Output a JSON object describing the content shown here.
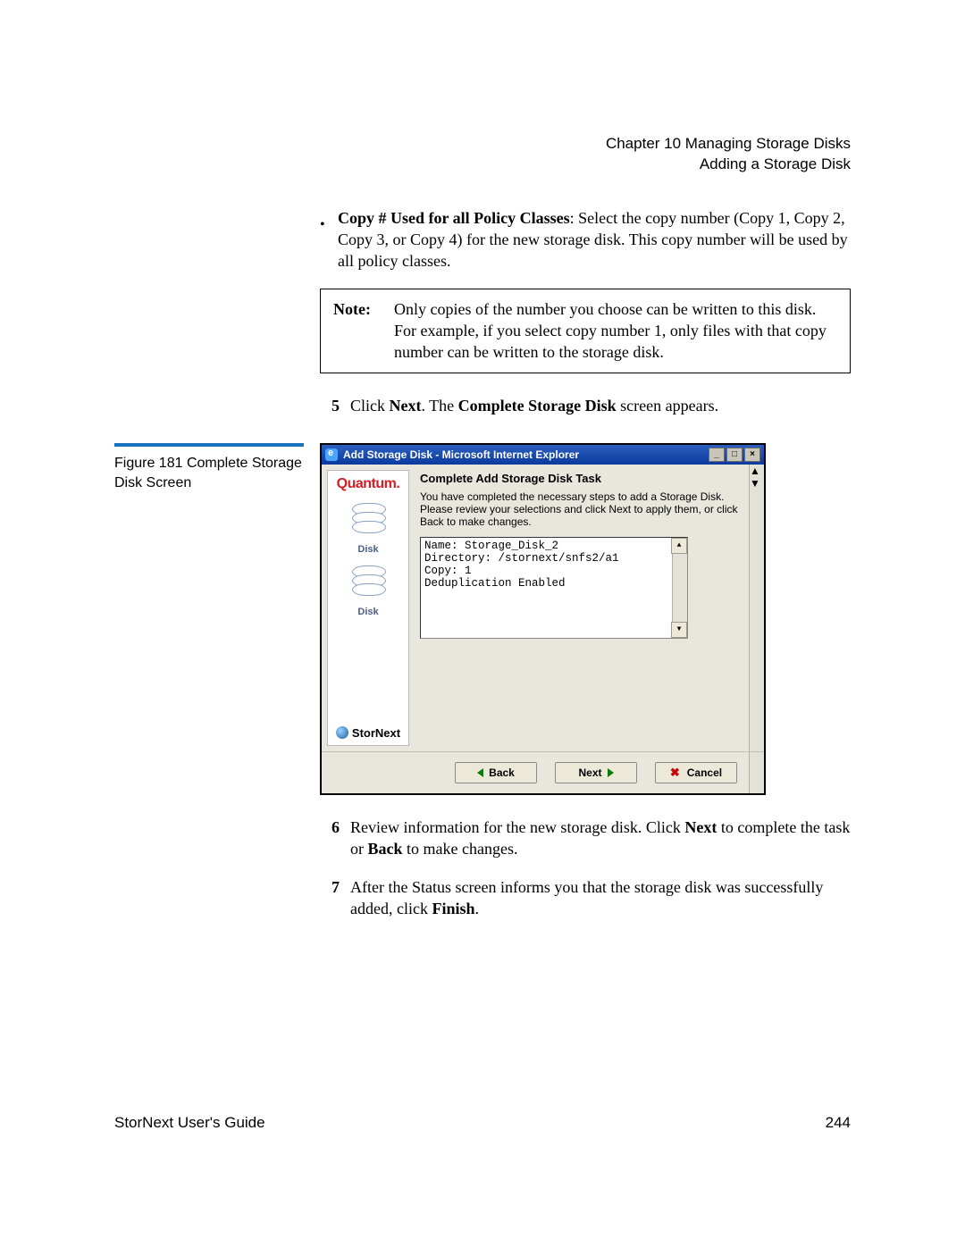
{
  "header": {
    "chapter": "Chapter 10  Managing Storage Disks",
    "section": "Adding a Storage Disk"
  },
  "bullet": {
    "label": "Copy # Used for all Policy Classes",
    "text": ": Select the copy number (Copy 1, Copy 2, Copy 3, or Copy 4) for the new storage disk. This copy number will be used by all policy classes."
  },
  "note": {
    "label": "Note:",
    "text": "Only copies of the number you choose can be written to this disk. For example, if you select copy number 1, only files with that copy number can be written to the storage disk."
  },
  "step5": {
    "num": "5",
    "a": "Click ",
    "b": "Next",
    "c": ". The ",
    "d": "Complete Storage Disk",
    "e": " screen appears."
  },
  "figure": {
    "caption": "Figure 181  Complete Storage Disk Screen"
  },
  "screenshot": {
    "title": "Add Storage Disk - Microsoft Internet Explorer",
    "brand": "Quantum.",
    "diskLabel": "Disk",
    "stornext": "StorNext",
    "heading": "Complete Add Storage Disk Task",
    "desc": "You have completed the necessary steps to add a Storage Disk. Please review your selections and click Next to apply them, or click Back to make changes.",
    "review": "Name: Storage_Disk_2\nDirectory: /stornext/snfs2/a1\nCopy: 1\nDeduplication Enabled",
    "buttons": {
      "back": "Back",
      "next": "Next",
      "cancel": "Cancel"
    }
  },
  "step6": {
    "num": "6",
    "a": "Review information for the new storage disk. Click ",
    "b": "Next",
    "c": " to complete the task or ",
    "d": "Back",
    "e": " to make changes."
  },
  "step7": {
    "num": "7",
    "a": "After the Status screen informs you that the storage disk was successfully added, click ",
    "b": "Finish",
    "c": "."
  },
  "footer": {
    "left": "StorNext User's Guide",
    "right": "244"
  }
}
